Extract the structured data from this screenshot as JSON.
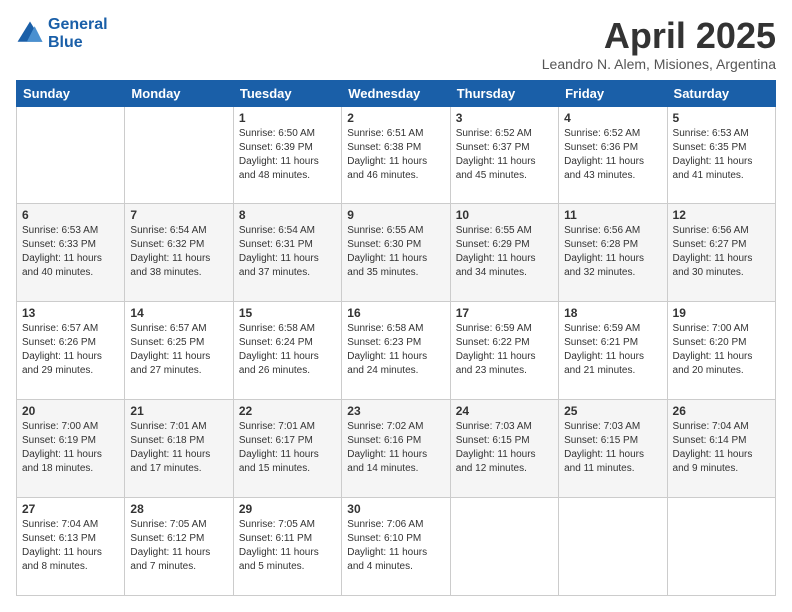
{
  "logo": {
    "line1": "General",
    "line2": "Blue"
  },
  "title": "April 2025",
  "subtitle": "Leandro N. Alem, Misiones, Argentina",
  "days_of_week": [
    "Sunday",
    "Monday",
    "Tuesday",
    "Wednesday",
    "Thursday",
    "Friday",
    "Saturday"
  ],
  "weeks": [
    [
      null,
      null,
      {
        "day": 1,
        "sunrise": "Sunrise: 6:50 AM",
        "sunset": "Sunset: 6:39 PM",
        "daylight": "Daylight: 11 hours and 48 minutes."
      },
      {
        "day": 2,
        "sunrise": "Sunrise: 6:51 AM",
        "sunset": "Sunset: 6:38 PM",
        "daylight": "Daylight: 11 hours and 46 minutes."
      },
      {
        "day": 3,
        "sunrise": "Sunrise: 6:52 AM",
        "sunset": "Sunset: 6:37 PM",
        "daylight": "Daylight: 11 hours and 45 minutes."
      },
      {
        "day": 4,
        "sunrise": "Sunrise: 6:52 AM",
        "sunset": "Sunset: 6:36 PM",
        "daylight": "Daylight: 11 hours and 43 minutes."
      },
      {
        "day": 5,
        "sunrise": "Sunrise: 6:53 AM",
        "sunset": "Sunset: 6:35 PM",
        "daylight": "Daylight: 11 hours and 41 minutes."
      }
    ],
    [
      {
        "day": 6,
        "sunrise": "Sunrise: 6:53 AM",
        "sunset": "Sunset: 6:33 PM",
        "daylight": "Daylight: 11 hours and 40 minutes."
      },
      {
        "day": 7,
        "sunrise": "Sunrise: 6:54 AM",
        "sunset": "Sunset: 6:32 PM",
        "daylight": "Daylight: 11 hours and 38 minutes."
      },
      {
        "day": 8,
        "sunrise": "Sunrise: 6:54 AM",
        "sunset": "Sunset: 6:31 PM",
        "daylight": "Daylight: 11 hours and 37 minutes."
      },
      {
        "day": 9,
        "sunrise": "Sunrise: 6:55 AM",
        "sunset": "Sunset: 6:30 PM",
        "daylight": "Daylight: 11 hours and 35 minutes."
      },
      {
        "day": 10,
        "sunrise": "Sunrise: 6:55 AM",
        "sunset": "Sunset: 6:29 PM",
        "daylight": "Daylight: 11 hours and 34 minutes."
      },
      {
        "day": 11,
        "sunrise": "Sunrise: 6:56 AM",
        "sunset": "Sunset: 6:28 PM",
        "daylight": "Daylight: 11 hours and 32 minutes."
      },
      {
        "day": 12,
        "sunrise": "Sunrise: 6:56 AM",
        "sunset": "Sunset: 6:27 PM",
        "daylight": "Daylight: 11 hours and 30 minutes."
      }
    ],
    [
      {
        "day": 13,
        "sunrise": "Sunrise: 6:57 AM",
        "sunset": "Sunset: 6:26 PM",
        "daylight": "Daylight: 11 hours and 29 minutes."
      },
      {
        "day": 14,
        "sunrise": "Sunrise: 6:57 AM",
        "sunset": "Sunset: 6:25 PM",
        "daylight": "Daylight: 11 hours and 27 minutes."
      },
      {
        "day": 15,
        "sunrise": "Sunrise: 6:58 AM",
        "sunset": "Sunset: 6:24 PM",
        "daylight": "Daylight: 11 hours and 26 minutes."
      },
      {
        "day": 16,
        "sunrise": "Sunrise: 6:58 AM",
        "sunset": "Sunset: 6:23 PM",
        "daylight": "Daylight: 11 hours and 24 minutes."
      },
      {
        "day": 17,
        "sunrise": "Sunrise: 6:59 AM",
        "sunset": "Sunset: 6:22 PM",
        "daylight": "Daylight: 11 hours and 23 minutes."
      },
      {
        "day": 18,
        "sunrise": "Sunrise: 6:59 AM",
        "sunset": "Sunset: 6:21 PM",
        "daylight": "Daylight: 11 hours and 21 minutes."
      },
      {
        "day": 19,
        "sunrise": "Sunrise: 7:00 AM",
        "sunset": "Sunset: 6:20 PM",
        "daylight": "Daylight: 11 hours and 20 minutes."
      }
    ],
    [
      {
        "day": 20,
        "sunrise": "Sunrise: 7:00 AM",
        "sunset": "Sunset: 6:19 PM",
        "daylight": "Daylight: 11 hours and 18 minutes."
      },
      {
        "day": 21,
        "sunrise": "Sunrise: 7:01 AM",
        "sunset": "Sunset: 6:18 PM",
        "daylight": "Daylight: 11 hours and 17 minutes."
      },
      {
        "day": 22,
        "sunrise": "Sunrise: 7:01 AM",
        "sunset": "Sunset: 6:17 PM",
        "daylight": "Daylight: 11 hours and 15 minutes."
      },
      {
        "day": 23,
        "sunrise": "Sunrise: 7:02 AM",
        "sunset": "Sunset: 6:16 PM",
        "daylight": "Daylight: 11 hours and 14 minutes."
      },
      {
        "day": 24,
        "sunrise": "Sunrise: 7:03 AM",
        "sunset": "Sunset: 6:15 PM",
        "daylight": "Daylight: 11 hours and 12 minutes."
      },
      {
        "day": 25,
        "sunrise": "Sunrise: 7:03 AM",
        "sunset": "Sunset: 6:15 PM",
        "daylight": "Daylight: 11 hours and 11 minutes."
      },
      {
        "day": 26,
        "sunrise": "Sunrise: 7:04 AM",
        "sunset": "Sunset: 6:14 PM",
        "daylight": "Daylight: 11 hours and 9 minutes."
      }
    ],
    [
      {
        "day": 27,
        "sunrise": "Sunrise: 7:04 AM",
        "sunset": "Sunset: 6:13 PM",
        "daylight": "Daylight: 11 hours and 8 minutes."
      },
      {
        "day": 28,
        "sunrise": "Sunrise: 7:05 AM",
        "sunset": "Sunset: 6:12 PM",
        "daylight": "Daylight: 11 hours and 7 minutes."
      },
      {
        "day": 29,
        "sunrise": "Sunrise: 7:05 AM",
        "sunset": "Sunset: 6:11 PM",
        "daylight": "Daylight: 11 hours and 5 minutes."
      },
      {
        "day": 30,
        "sunrise": "Sunrise: 7:06 AM",
        "sunset": "Sunset: 6:10 PM",
        "daylight": "Daylight: 11 hours and 4 minutes."
      },
      null,
      null,
      null
    ]
  ]
}
